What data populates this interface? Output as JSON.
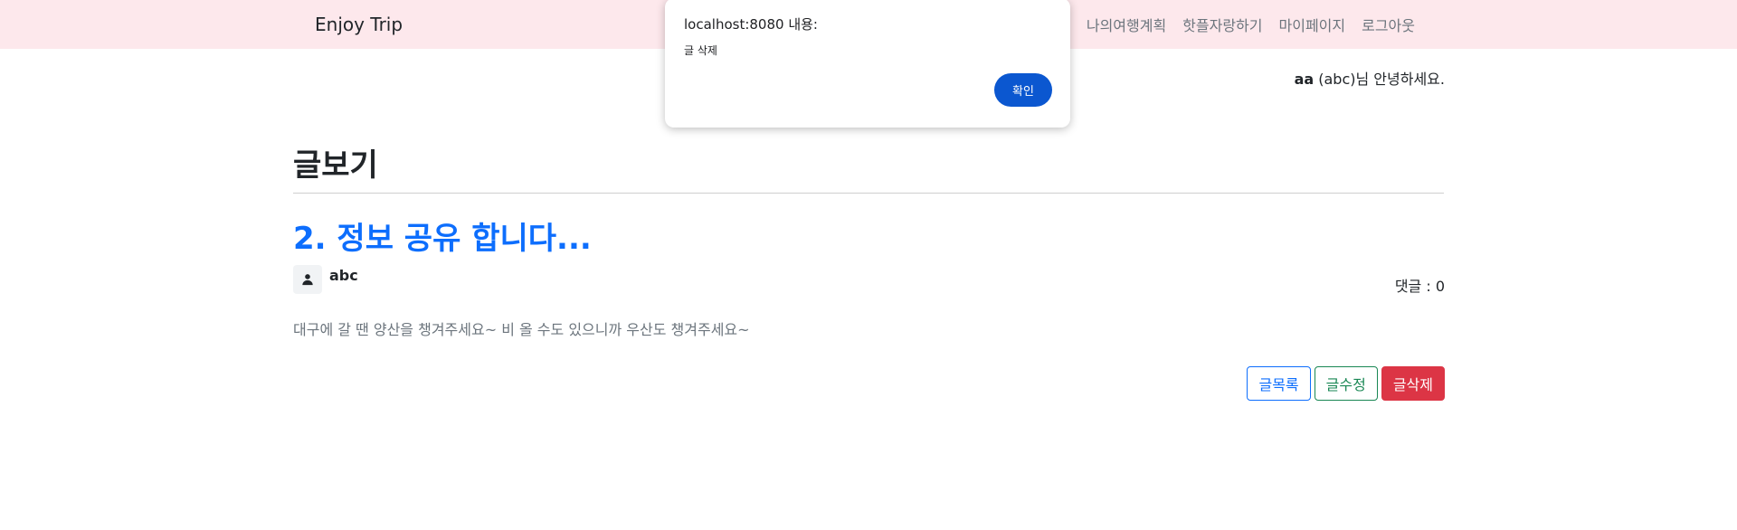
{
  "navbar": {
    "brand": "Enjoy Trip",
    "links": [
      "나의여행계획",
      "핫플자랑하기",
      "마이페이지",
      "로그아웃"
    ]
  },
  "greeting": {
    "user_id": "aa",
    "suffix": " (abc)님 안녕하세요."
  },
  "page": {
    "title": "글보기"
  },
  "article": {
    "title": "2. 정보 공유 합니다...",
    "author": "abc",
    "comment_count": "댓글 : 0",
    "content": "대구에 갈 땐 양산을 챙겨주세요~ 비 올 수도 있으니까 우산도 챙겨주세요~"
  },
  "buttons": {
    "list": "글목록",
    "edit": "글수정",
    "delete": "글삭제"
  },
  "dialog": {
    "title": "localhost:8080 내용:",
    "message": "글 삭제",
    "ok_label": "확인"
  },
  "colors": {
    "navbar_bg": "#fde8ec",
    "primary": "#0d6efd",
    "success": "#198754",
    "danger": "#dc3545",
    "dialog_button": "#0b57d0"
  },
  "icons": {
    "author_avatar": "person-icon"
  }
}
